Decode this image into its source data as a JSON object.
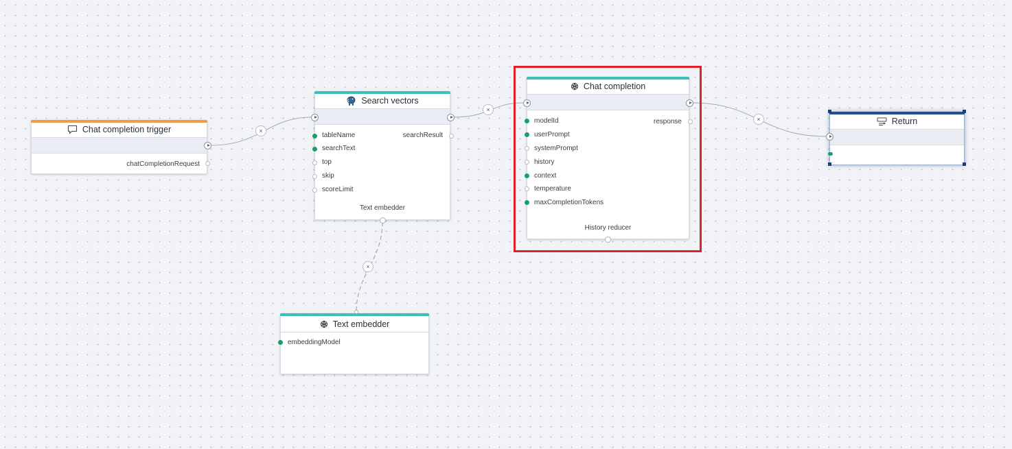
{
  "nodes": {
    "trigger": {
      "title": "Chat completion trigger",
      "icon": "chat-bubble-icon",
      "accent_color": "#f2994a",
      "outputs": [
        "chatCompletionRequest"
      ]
    },
    "search": {
      "title": "Search vectors",
      "icon": "postgres-elephant-icon",
      "accent_color": "#3bbfb8",
      "inputs": [
        "tableName",
        "searchText",
        "top",
        "skip",
        "scoreLimit"
      ],
      "inputs_connected": [
        true,
        true,
        false,
        false,
        false
      ],
      "outputs": [
        "searchResult"
      ],
      "footer": "Text embedder"
    },
    "chat": {
      "title": "Chat completion",
      "icon": "openai-logo-icon",
      "accent_color": "#3bbfb8",
      "inputs": [
        "modelId",
        "userPrompt",
        "systemPrompt",
        "history",
        "context",
        "temperature",
        "maxCompletionTokens"
      ],
      "inputs_connected": [
        true,
        true,
        false,
        false,
        true,
        false,
        true
      ],
      "outputs": [
        "response"
      ],
      "footer": "History reducer",
      "highlighted": true,
      "highlight_color": "#e0202a"
    },
    "return": {
      "title": "Return",
      "icon": "return-icon",
      "accent_color": "#1f4f8f",
      "selected": true
    },
    "embedder": {
      "title": "Text embedder",
      "icon": "openai-logo-icon",
      "accent_color": "#3bbfb8",
      "inputs": [
        "embeddingModel"
      ],
      "inputs_connected": [
        true
      ]
    }
  }
}
